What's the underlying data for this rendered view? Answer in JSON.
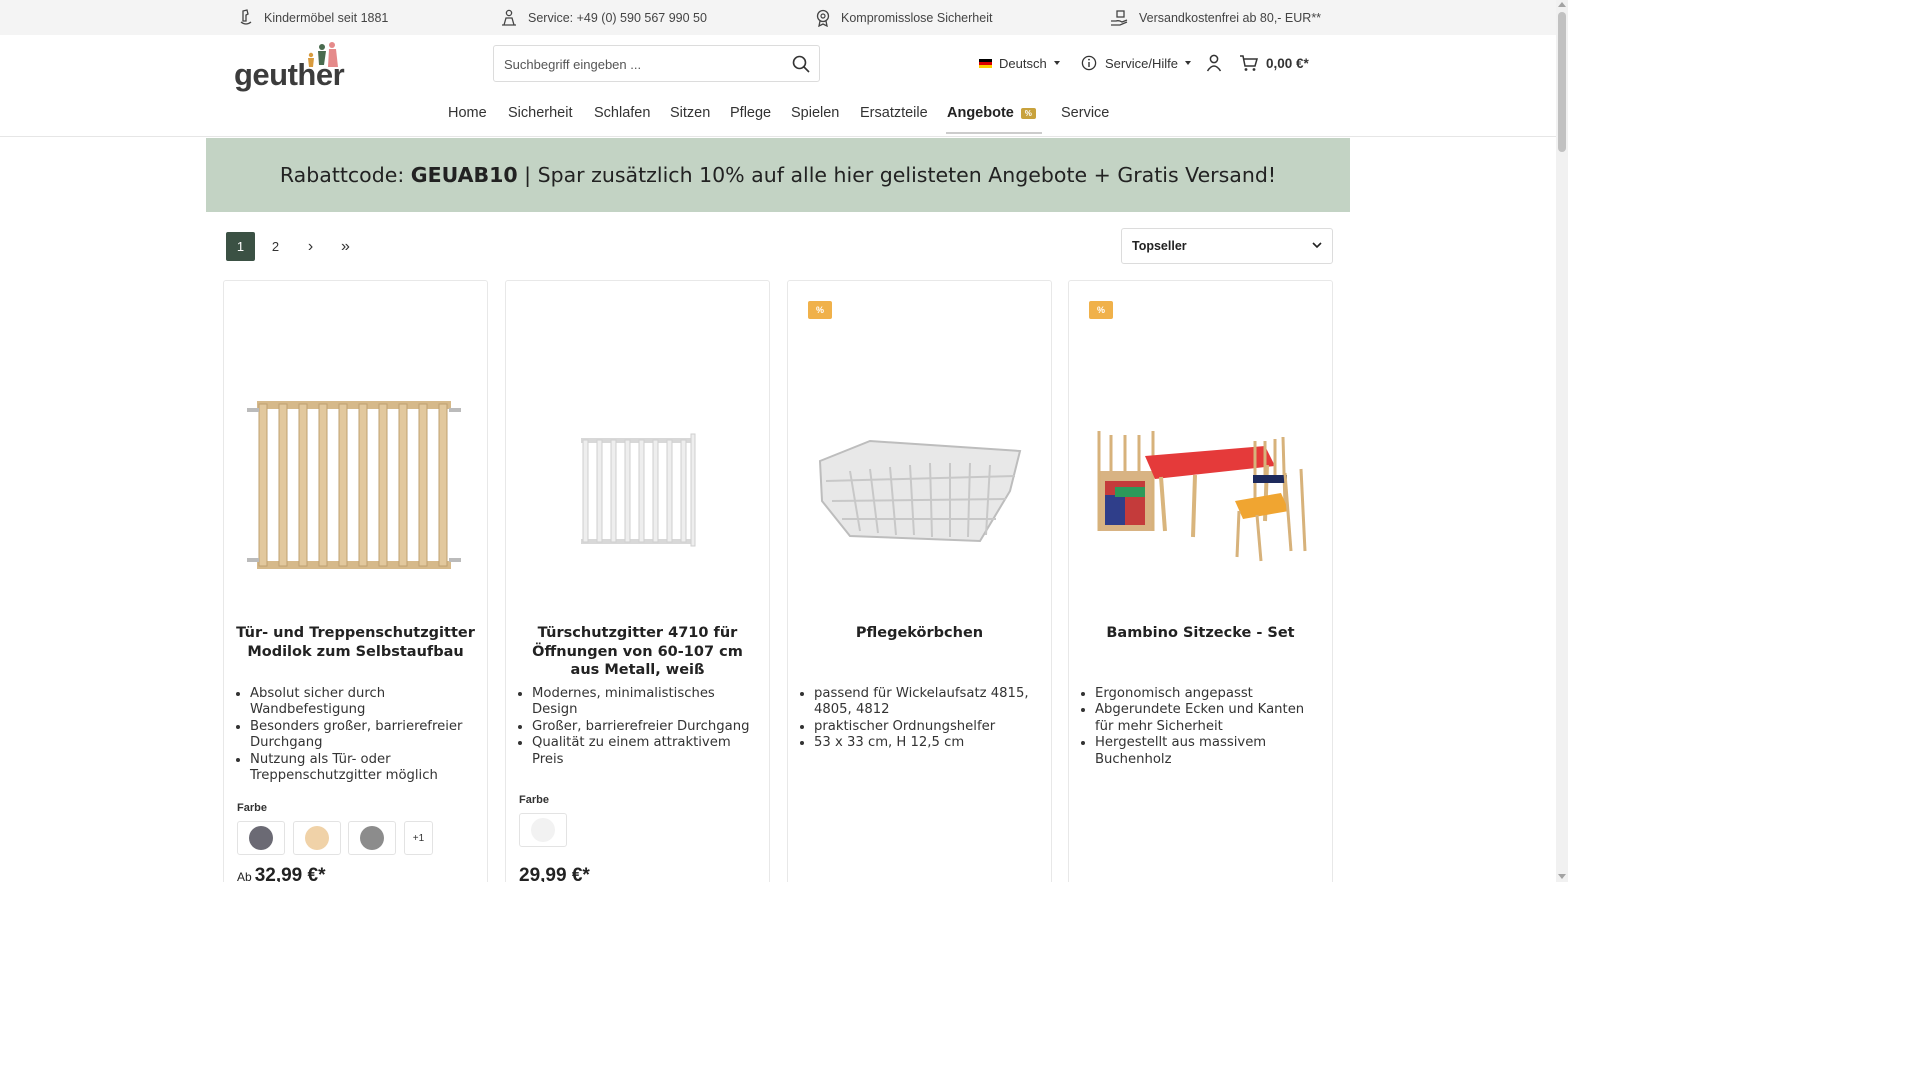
{
  "usp_bar": {
    "items": [
      {
        "icon": "rocking-horse-icon",
        "text": "Kindermöbel seit 1881"
      },
      {
        "icon": "service-person-icon",
        "text": "Service: +49 (0) 590 567 990 50"
      },
      {
        "icon": "safety-award-icon",
        "text": "Kompromisslose Sicherheit"
      },
      {
        "icon": "hand-package-icon",
        "text": "Versandkostenfrei ab 80,- EUR**"
      }
    ]
  },
  "header": {
    "logo_text": "geuther",
    "search": {
      "placeholder": "Suchbegriff eingeben ...",
      "value": ""
    },
    "language": "Deutsch",
    "service_menu": "Service/Hilfe",
    "cart_total": "0,00 €*",
    "nav": [
      {
        "label": "Home"
      },
      {
        "label": "Sicherheit"
      },
      {
        "label": "Schlafen"
      },
      {
        "label": "Sitzen"
      },
      {
        "label": "Pflege"
      },
      {
        "label": "Spielen"
      },
      {
        "label": "Ersatzteile"
      },
      {
        "label": "Angebote",
        "badge": "%",
        "active": true
      },
      {
        "label": "Service"
      }
    ]
  },
  "promo": {
    "prefix": "Rabattcode: ",
    "code": "GEUAB10",
    "suffix": " | Spar zusätzlich 10% auf alle hier gelisteten Angebote + Gratis Versand!"
  },
  "pagination": {
    "pages": [
      "1",
      "2"
    ],
    "current": "1",
    "next": "›",
    "last": "»"
  },
  "sort": {
    "selected": "Topseller"
  },
  "colors": {
    "accent": "#3b5144",
    "promo_bg": "#c3d3c4",
    "badge_orange": "#f0b14a",
    "nav_badge": "#c8a23c"
  },
  "products": [
    {
      "title": "Tür- und Treppenschutzgitter Modilok zum Selbstaufbau",
      "features": [
        "Absolut sicher durch Wandbefestigung",
        "Besonders großer, barrierefreier Durchgang",
        "Nutzung als Tür- oder Treppenschutzgitter möglich"
      ],
      "farbe_label": "Farbe",
      "swatches": [
        "#6b6a74",
        "#f0d2a8",
        "#8c8c8c"
      ],
      "more_swatches": "+1",
      "price_prefix": "Ab",
      "price": "32,99 €*"
    },
    {
      "title": "Türschutzgitter 4710 für Öffnungen von 60-107 cm aus Metall, weiß",
      "features": [
        "Modernes, minimalistisches Design",
        "Großer, barrierefreier Durchgang",
        "Qualität zu einem attraktivem Preis"
      ],
      "farbe_label": "Farbe",
      "swatches": [
        "#f2f2f2"
      ],
      "price": "29,99 €*"
    },
    {
      "badge": "%",
      "title": "Pflegekörbchen",
      "features": [
        "passend für Wickelaufsatz 4815, 4805, 4812",
        "praktischer Ordnungshelfer",
        "53 x 33 cm, H 12,5 cm"
      ]
    },
    {
      "badge": "%",
      "title": "Bambino Sitzecke - Set",
      "features": [
        "Ergonomisch angepasst",
        "Abgerundete Ecken und Kanten für mehr Sicherheit",
        "Hergestellt aus massivem Buchenholz"
      ]
    }
  ]
}
